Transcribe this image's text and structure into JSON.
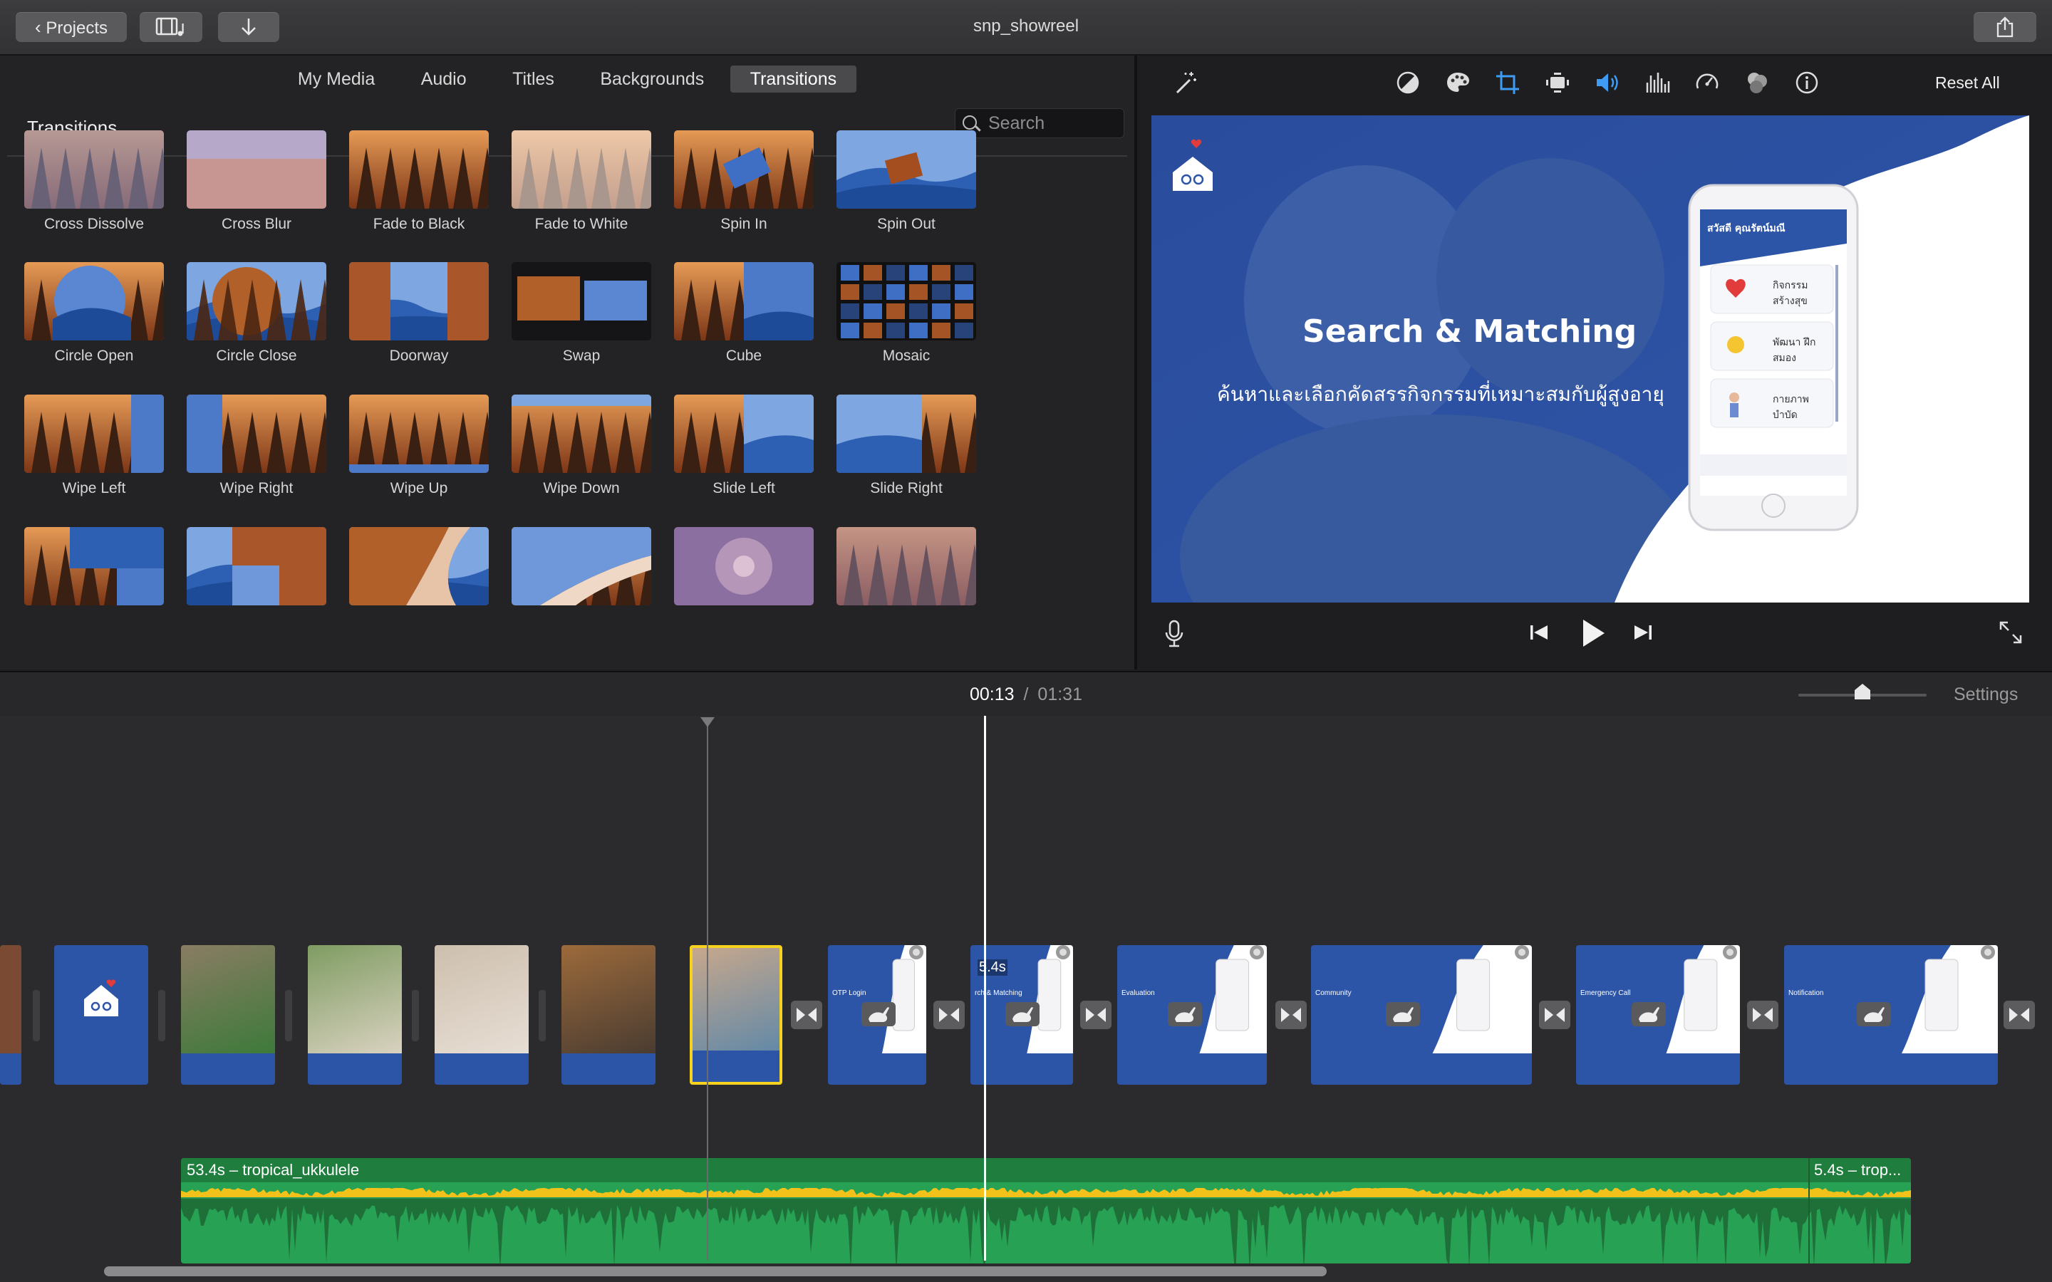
{
  "window": {
    "title": "snp_showreel"
  },
  "toolbar": {
    "projects_label": "Projects"
  },
  "browser": {
    "tabs": [
      {
        "label": "My Media"
      },
      {
        "label": "Audio"
      },
      {
        "label": "Titles"
      },
      {
        "label": "Backgrounds"
      },
      {
        "label": "Transitions",
        "active": true
      }
    ],
    "title": "Transitions",
    "search_placeholder": "Search",
    "transitions": [
      "Cross Dissolve",
      "Cross Blur",
      "Fade to Black",
      "Fade to White",
      "Spin In",
      "Spin Out",
      "Circle Open",
      "Circle Close",
      "Doorway",
      "Swap",
      "Cube",
      "Mosaic",
      "Wipe Left",
      "Wipe Right",
      "Wipe Up",
      "Wipe Down",
      "Slide Left",
      "Slide Right",
      "",
      "",
      "",
      "",
      "",
      ""
    ]
  },
  "viewer": {
    "reset_label": "Reset All",
    "slide": {
      "heading": "Search & Matching",
      "subtitle": "ค้นหาและเลือกคัดสรรกิจกรรมที่เหมาะสมกับผู้สูงอายุ",
      "phone_header": "สวัสดี คุณรัตน์มณี",
      "phone_items": [
        "กิจกรรม สร้างสุข",
        "พัฒนา ฝึกสมอง",
        "กายภาพ บำบัด"
      ]
    }
  },
  "timeline": {
    "current_time": "00:13",
    "separator": "/",
    "total_time": "01:31",
    "settings_label": "Settings",
    "zoom_level": 0.5,
    "clip_duration_badge": "5.4s",
    "clip_captions": [
      "OTP Login",
      "rch & Matching",
      "Evaluation",
      "Community",
      "Emergency Call",
      "Notification"
    ],
    "audio": [
      {
        "label": "53.4s – tropical_ukkulele"
      },
      {
        "label": "5.4s – trop..."
      }
    ]
  },
  "colors": {
    "accent_blue": "#2c55a8",
    "audio_green": "#27a154",
    "waveform_yellow": "#f2c21a",
    "selection_yellow": "#f6d21f"
  }
}
